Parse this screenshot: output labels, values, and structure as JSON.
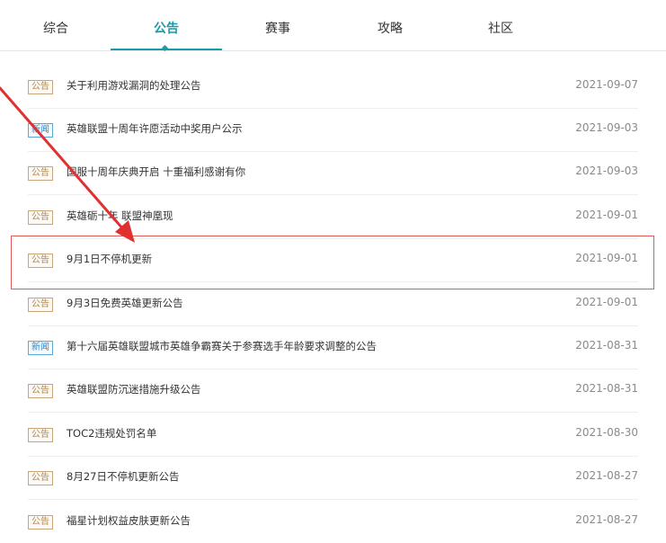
{
  "tabs": [
    {
      "label": "综合"
    },
    {
      "label": "公告"
    },
    {
      "label": "赛事"
    },
    {
      "label": "攻略"
    },
    {
      "label": "社区"
    }
  ],
  "active_tab": "公告",
  "items": [
    {
      "badge": "公告",
      "title": "关于利用游戏漏洞的处理公告",
      "date": "2021-09-07"
    },
    {
      "badge": "新闻",
      "title": "英雄联盟十周年许愿活动中奖用户公示",
      "date": "2021-09-03"
    },
    {
      "badge": "公告",
      "title": "国服十周年庆典开启 十重福利感谢有你",
      "date": "2021-09-03"
    },
    {
      "badge": "公告",
      "title": "英雄砺十年 联盟神凰现",
      "date": "2021-09-01"
    },
    {
      "badge": "公告",
      "title": "9月1日不停机更新",
      "date": "2021-09-01"
    },
    {
      "badge": "公告",
      "title": "9月3日免费英雄更新公告",
      "date": "2021-09-01"
    },
    {
      "badge": "新闻",
      "title": "第十六届英雄联盟城市英雄争霸赛关于参赛选手年龄要求调整的公告",
      "date": "2021-08-31"
    },
    {
      "badge": "公告",
      "title": "英雄联盟防沉迷措施升级公告",
      "date": "2021-08-31"
    },
    {
      "badge": "公告",
      "title": "TOC2违规处罚名单",
      "date": "2021-08-30"
    },
    {
      "badge": "公告",
      "title": "8月27日不停机更新公告",
      "date": "2021-08-27"
    },
    {
      "badge": "公告",
      "title": "福星计划权益皮肤更新公告",
      "date": "2021-08-27"
    }
  ],
  "colors": {
    "accent": "#1b9aa8",
    "badge_notice": "#b08651",
    "badge_news": "#2b88c7",
    "annotation": "#e03030"
  }
}
